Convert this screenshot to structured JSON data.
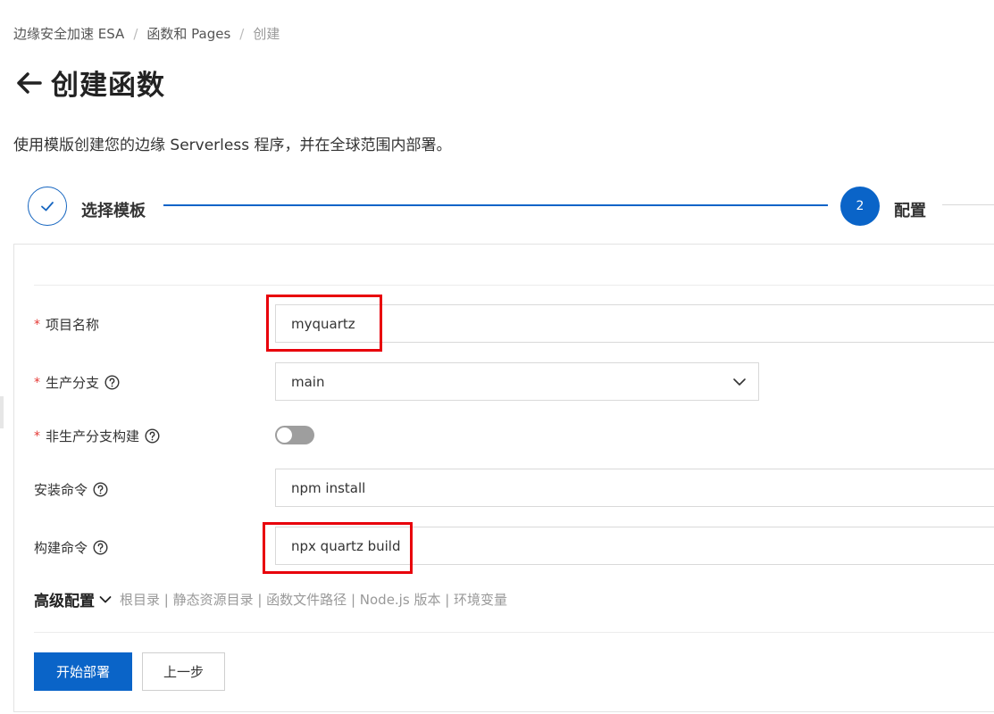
{
  "breadcrumb": {
    "items": [
      "边缘安全加速 ESA",
      "函数和 Pages",
      "创建"
    ],
    "separator": "/"
  },
  "header": {
    "title": "创建函数",
    "back_icon": "arrow-left-icon"
  },
  "description": "使用模版创建您的边缘 Serverless 程序，并在全球范围内部署。",
  "steps": [
    {
      "label": "选择模板",
      "status": "done",
      "icon": "check-icon"
    },
    {
      "label": "配置",
      "status": "active",
      "number": "2"
    }
  ],
  "form": {
    "project_name": {
      "label": "项目名称",
      "required": true,
      "value": "myquartz"
    },
    "production_branch": {
      "label": "生产分支",
      "required": true,
      "value": "main"
    },
    "non_production_build": {
      "label": "非生产分支构建",
      "required": true,
      "enabled": false
    },
    "install_command": {
      "label": "安装命令",
      "required": false,
      "value": "npm install"
    },
    "build_command": {
      "label": "构建命令",
      "required": false,
      "value": "npx quartz build"
    }
  },
  "advanced": {
    "title": "高级配置",
    "items_text": "根目录 | 静态资源目录 | 函数文件路径 | Node.js 版本 | 环境变量"
  },
  "buttons": {
    "deploy": "开始部署",
    "previous": "上一步"
  },
  "colors": {
    "primary": "#0a64c8",
    "highlight": "#e8000b",
    "required": "#e53935"
  }
}
